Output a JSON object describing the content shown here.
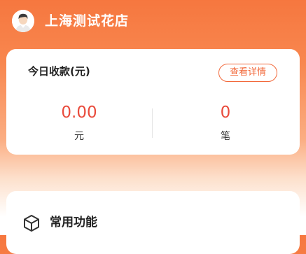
{
  "header": {
    "shop_name": "上海测试花店",
    "avatar_icon": "user-avatar-icon"
  },
  "revenue_card": {
    "title": "今日收款(元)",
    "detail_button": "查看详情",
    "amount_value": "0.00",
    "amount_unit": "元",
    "count_value": "0",
    "count_unit": "笔"
  },
  "functions_card": {
    "title": "常用功能",
    "icon": "cube-icon"
  },
  "colors": {
    "accent": "#f2683a",
    "value_red": "#e94b3c",
    "header_orange": "#f6773f"
  }
}
